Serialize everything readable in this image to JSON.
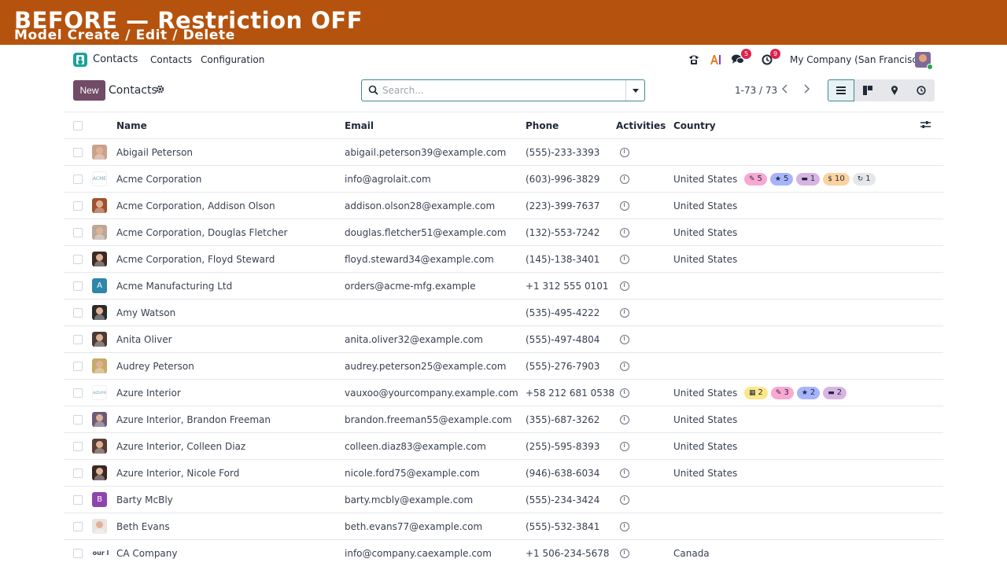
{
  "banner": {
    "title": "BEFORE — Restriction OFF",
    "subtitle": "Model Create / Edit / Delete"
  },
  "topnav": {
    "app_name": "Contacts",
    "menu": [
      "Contacts",
      "Configuration"
    ],
    "messages_count": "5",
    "activities_count": "9",
    "company": "My Company (San Francisco)"
  },
  "control": {
    "new_label": "New",
    "title": "Contacts",
    "search_placeholder": "Search...",
    "pager": "1-73 / 73"
  },
  "table": {
    "headers": {
      "name": "Name",
      "email": "Email",
      "phone": "Phone",
      "activities": "Activities",
      "country": "Country"
    },
    "rows": [
      {
        "name": "Abigail Peterson",
        "email": "abigail.peterson39@example.com",
        "phone": "(555)-233-3393",
        "country": "",
        "avatar_color": "#c9a28d"
      },
      {
        "name": "Acme Corporation",
        "email": "info@agrolait.com",
        "phone": "(603)-996-3829",
        "country": "United States",
        "avatar_text": "ACME"
      },
      {
        "name": "Acme Corporation, Addison Olson",
        "email": "addison.olson28@example.com",
        "phone": "(223)-399-7637",
        "country": "United States",
        "avatar_color": "#a0522d"
      },
      {
        "name": "Acme Corporation, Douglas Fletcher",
        "email": "douglas.fletcher51@example.com",
        "phone": "(132)-553-7242",
        "country": "United States",
        "avatar_color": "#b8a99a"
      },
      {
        "name": "Acme Corporation, Floyd Steward",
        "email": "floyd.steward34@example.com",
        "phone": "(145)-138-3401",
        "country": "United States",
        "avatar_color": "#3b2a24"
      },
      {
        "name": "Acme Manufacturing Ltd",
        "email": "orders@acme-mfg.example",
        "phone": "+1 312 555 0101",
        "country": "",
        "avatar_letter": "A",
        "avatar_color": "#2e86ab"
      },
      {
        "name": "Amy Watson",
        "email": "",
        "phone": "(535)-495-4222",
        "country": "",
        "avatar_color": "#2b2b2b"
      },
      {
        "name": "Anita Oliver",
        "email": "anita.oliver32@example.com",
        "phone": "(555)-497-4804",
        "country": "",
        "avatar_color": "#4a3b36"
      },
      {
        "name": "Audrey Peterson",
        "email": "audrey.peterson25@example.com",
        "phone": "(555)-276-7903",
        "country": "",
        "avatar_color": "#c8a96a"
      },
      {
        "name": "Azure Interior",
        "email": "vauxoo@yourcompany.example.com",
        "phone": "+58 212 681 0538",
        "country": "United States",
        "avatar_text": "azure"
      },
      {
        "name": "Azure Interior, Brandon Freeman",
        "email": "brandon.freeman55@example.com",
        "phone": "(355)-687-3262",
        "country": "United States",
        "avatar_color": "#6d5a78"
      },
      {
        "name": "Azure Interior, Colleen Diaz",
        "email": "colleen.diaz83@example.com",
        "phone": "(255)-595-8393",
        "country": "United States",
        "avatar_color": "#5a3e36"
      },
      {
        "name": "Azure Interior, Nicole Ford",
        "email": "nicole.ford75@example.com",
        "phone": "(946)-638-6034",
        "country": "United States",
        "avatar_color": "#3a2622"
      },
      {
        "name": "Barty McBly",
        "email": "barty.mcbly@example.com",
        "phone": "(555)-234-3424",
        "country": "",
        "avatar_letter": "B",
        "avatar_color": "#8e44ad"
      },
      {
        "name": "Beth Evans",
        "email": "beth.evans77@example.com",
        "phone": "(555)-532-3841",
        "country": "",
        "avatar_color": "#e9e4df"
      },
      {
        "name": "CA Company",
        "email": "info@company.caexample.com",
        "phone": "+1 506-234-5678",
        "country": "Canada",
        "avatar_text": "our l"
      }
    ],
    "tags": {
      "row1": [
        {
          "icon": "✎",
          "count": "5",
          "color": "#f9a8d4"
        },
        {
          "icon": "★",
          "count": "5",
          "color": "#a5b4fc"
        },
        {
          "icon": "▬",
          "count": "1",
          "color": "#d8b4e2"
        },
        {
          "icon": "$",
          "count": "10",
          "color": "#fcd29f"
        },
        {
          "icon": "↻",
          "count": "1",
          "color": "#e5e7eb"
        }
      ],
      "row9": [
        {
          "icon": "▦",
          "count": "2",
          "color": "#fde68a"
        },
        {
          "icon": "✎",
          "count": "3",
          "color": "#f9a8d4"
        },
        {
          "icon": "★",
          "count": "2",
          "color": "#a5b4fc"
        },
        {
          "icon": "▬",
          "count": "2",
          "color": "#d8b4e2"
        }
      ]
    }
  }
}
